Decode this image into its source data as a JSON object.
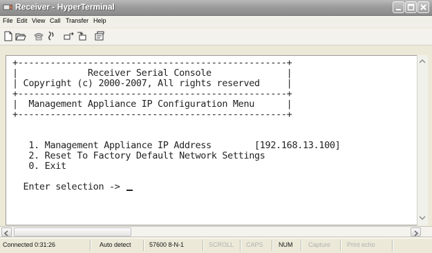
{
  "window": {
    "title": "Receiver - HyperTerminal"
  },
  "menubar": {
    "items": [
      "File",
      "Edit",
      "View",
      "Call",
      "Transfer",
      "Help"
    ]
  },
  "toolbar": {
    "icons": [
      "new-document-icon",
      "open-folder-icon",
      "phone-connect-icon",
      "phone-disconnect-icon",
      "send-file-icon",
      "receive-file-icon",
      "properties-icon"
    ]
  },
  "terminal": {
    "lines": [
      "+--------------------------------------------------+",
      "|             Receiver Serial Console              |",
      "| Copyright (c) 2000-2007, All rights reserved     |",
      "+--------------------------------------------------+",
      "|  Management Appliance IP Configuration Menu      |",
      "+--------------------------------------------------+",
      "",
      "",
      "   1. Management Appliance IP Address        [192.168.13.100]",
      "   2. Reset To Factory Default Network Settings",
      "   0. Exit",
      "",
      "  Enter selection -> "
    ]
  },
  "statusbar": {
    "connected": "Connected 0:31:26",
    "detect": "Auto detect",
    "settings": "57600 8-N-1",
    "scroll": "SCROLL",
    "caps": "CAPS",
    "num": "NUM",
    "capture": "Capture",
    "print_echo": "Print echo"
  }
}
